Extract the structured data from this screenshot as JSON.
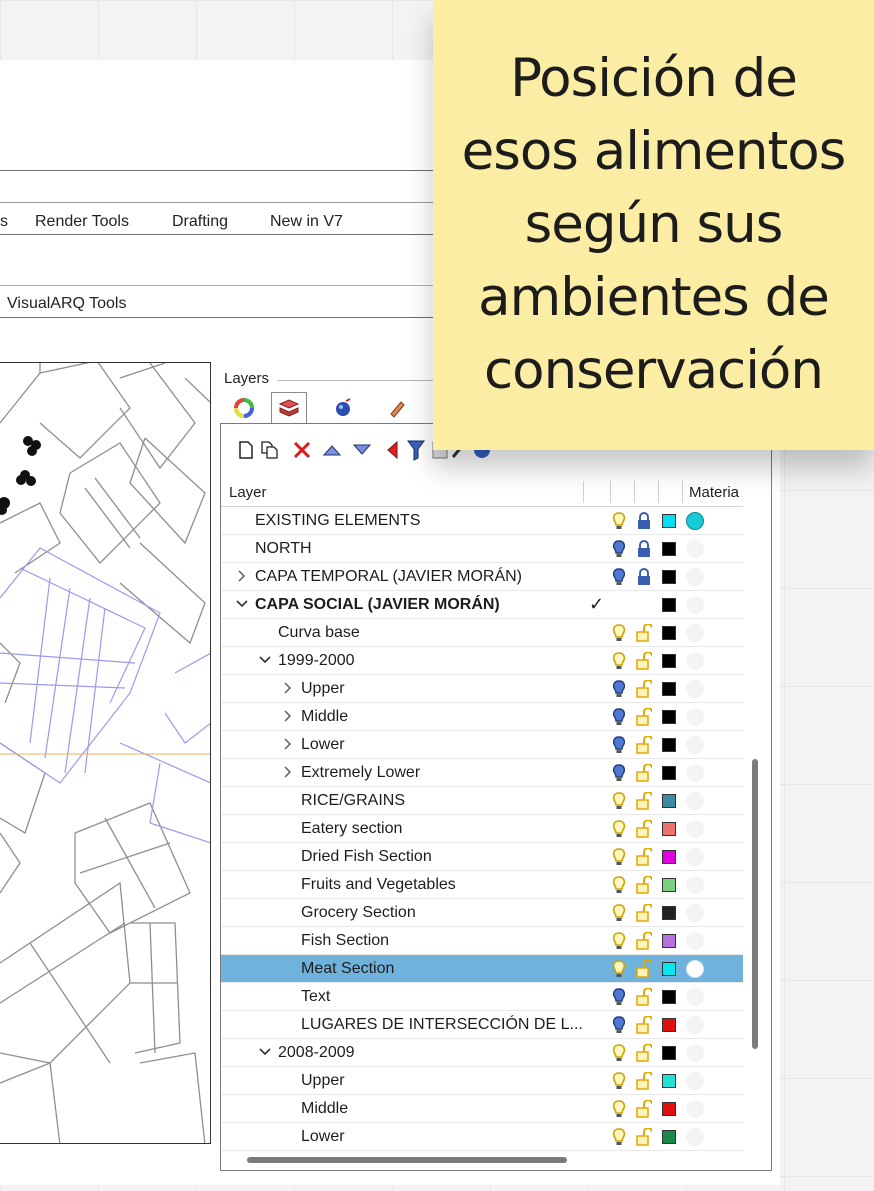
{
  "ribbon": {
    "tabs": [
      "s",
      "Render Tools",
      "Drafting",
      "New in V7"
    ],
    "toolbar_label": "VisualARQ Tools"
  },
  "layers_panel": {
    "caption": "Layers",
    "tab_icons": [
      "color-wheel-icon",
      "layers-icon",
      "material-sphere-icon",
      "pencil-icon"
    ],
    "toolbar_icons": [
      "new-layer-icon",
      "new-sublayer-icon",
      "delete-icon",
      "move-up-icon",
      "move-down-icon",
      "move-out-icon",
      "filter-icon",
      "page-icon",
      "tools-icon",
      "help-icon"
    ],
    "columns": {
      "layer": "Layer",
      "material": "Materia"
    },
    "rows": [
      {
        "name": "EXISTING ELEMENTS",
        "level": 0,
        "expander": "",
        "bulb": "on",
        "lock": "locked",
        "color": "#00e0f0",
        "material": "#19c9d6",
        "current": false,
        "selected": false,
        "bold": false
      },
      {
        "name": "NORTH",
        "level": 0,
        "expander": "",
        "bulb": "off",
        "lock": "locked",
        "color": "#000000",
        "material": "",
        "current": false,
        "selected": false,
        "bold": false
      },
      {
        "name": "CAPA TEMPORAL (JAVIER MORÁN)",
        "level": 0,
        "expander": "collapsed",
        "bulb": "off",
        "lock": "locked",
        "color": "#000000",
        "material": "",
        "current": false,
        "selected": false,
        "bold": false
      },
      {
        "name": "CAPA SOCIAL (JAVIER MORÁN)",
        "level": 0,
        "expander": "expanded",
        "bulb": "",
        "lock": "",
        "color": "#000000",
        "material": "",
        "current": true,
        "selected": false,
        "bold": true
      },
      {
        "name": "Curva base",
        "level": 1,
        "expander": "",
        "bulb": "on",
        "lock": "unlocked",
        "color": "#000000",
        "material": "",
        "current": false,
        "selected": false,
        "bold": false
      },
      {
        "name": "1999-2000",
        "level": 1,
        "expander": "expanded",
        "bulb": "on",
        "lock": "unlocked",
        "color": "#000000",
        "material": "",
        "current": false,
        "selected": false,
        "bold": false
      },
      {
        "name": "Upper",
        "level": 2,
        "expander": "collapsed",
        "bulb": "off",
        "lock": "unlocked",
        "color": "#000000",
        "material": "",
        "current": false,
        "selected": false,
        "bold": false
      },
      {
        "name": "Middle",
        "level": 2,
        "expander": "collapsed",
        "bulb": "off",
        "lock": "unlocked",
        "color": "#000000",
        "material": "",
        "current": false,
        "selected": false,
        "bold": false
      },
      {
        "name": "Lower",
        "level": 2,
        "expander": "collapsed",
        "bulb": "off",
        "lock": "unlocked",
        "color": "#000000",
        "material": "",
        "current": false,
        "selected": false,
        "bold": false
      },
      {
        "name": "Extremely Lower",
        "level": 2,
        "expander": "collapsed",
        "bulb": "off",
        "lock": "unlocked",
        "color": "#000000",
        "material": "",
        "current": false,
        "selected": false,
        "bold": false
      },
      {
        "name": "RICE/GRAINS",
        "level": 2,
        "expander": "",
        "bulb": "on",
        "lock": "unlocked",
        "color": "#3a8ba3",
        "material": "",
        "current": false,
        "selected": false,
        "bold": false
      },
      {
        "name": "Eatery section",
        "level": 2,
        "expander": "",
        "bulb": "on",
        "lock": "unlocked",
        "color": "#f07070",
        "material": "",
        "current": false,
        "selected": false,
        "bold": false
      },
      {
        "name": "Dried Fish Section",
        "level": 2,
        "expander": "",
        "bulb": "on",
        "lock": "unlocked",
        "color": "#e000e0",
        "material": "",
        "current": false,
        "selected": false,
        "bold": false
      },
      {
        "name": "Fruits and Vegetables",
        "level": 2,
        "expander": "",
        "bulb": "on",
        "lock": "unlocked",
        "color": "#7ed07e",
        "material": "",
        "current": false,
        "selected": false,
        "bold": false
      },
      {
        "name": "Grocery Section",
        "level": 2,
        "expander": "",
        "bulb": "on",
        "lock": "unlocked",
        "color": "#222222",
        "material": "",
        "current": false,
        "selected": false,
        "bold": false
      },
      {
        "name": "Fish Section",
        "level": 2,
        "expander": "",
        "bulb": "on",
        "lock": "unlocked",
        "color": "#b870e0",
        "material": "",
        "current": false,
        "selected": false,
        "bold": false
      },
      {
        "name": "Meat Section",
        "level": 2,
        "expander": "",
        "bulb": "on",
        "lock": "unlocked",
        "color": "#00e8f0",
        "material": "#ffffff",
        "current": false,
        "selected": true,
        "bold": false
      },
      {
        "name": "Text",
        "level": 2,
        "expander": "",
        "bulb": "off",
        "lock": "unlocked",
        "color": "#000000",
        "material": "",
        "current": false,
        "selected": false,
        "bold": false
      },
      {
        "name": "LUGARES DE INTERSECCIÓN DE L...",
        "level": 2,
        "expander": "",
        "bulb": "off",
        "lock": "unlocked",
        "color": "#e01010",
        "material": "",
        "current": false,
        "selected": false,
        "bold": false
      },
      {
        "name": "2008-2009",
        "level": 1,
        "expander": "expanded",
        "bulb": "on",
        "lock": "unlocked",
        "color": "#000000",
        "material": "",
        "current": false,
        "selected": false,
        "bold": false
      },
      {
        "name": "Upper",
        "level": 2,
        "expander": "",
        "bulb": "on",
        "lock": "unlocked",
        "color": "#20e0d8",
        "material": "",
        "current": false,
        "selected": false,
        "bold": false
      },
      {
        "name": "Middle",
        "level": 2,
        "expander": "",
        "bulb": "on",
        "lock": "unlocked",
        "color": "#e01010",
        "material": "",
        "current": false,
        "selected": false,
        "bold": false
      },
      {
        "name": "Lower",
        "level": 2,
        "expander": "",
        "bulb": "on",
        "lock": "unlocked",
        "color": "#1a8a4a",
        "material": "",
        "current": false,
        "selected": false,
        "bold": false
      }
    ]
  },
  "sticky_note": {
    "text": "Posición de\nesos alimentos\n según sus\nambientes de\nconservación",
    "color": "#fbeea4"
  },
  "colors": {
    "selection": "#6fb3dd",
    "bulb_on": "#e8c600",
    "bulb_off": "#3a5fb0",
    "lock": "#e3a800"
  }
}
